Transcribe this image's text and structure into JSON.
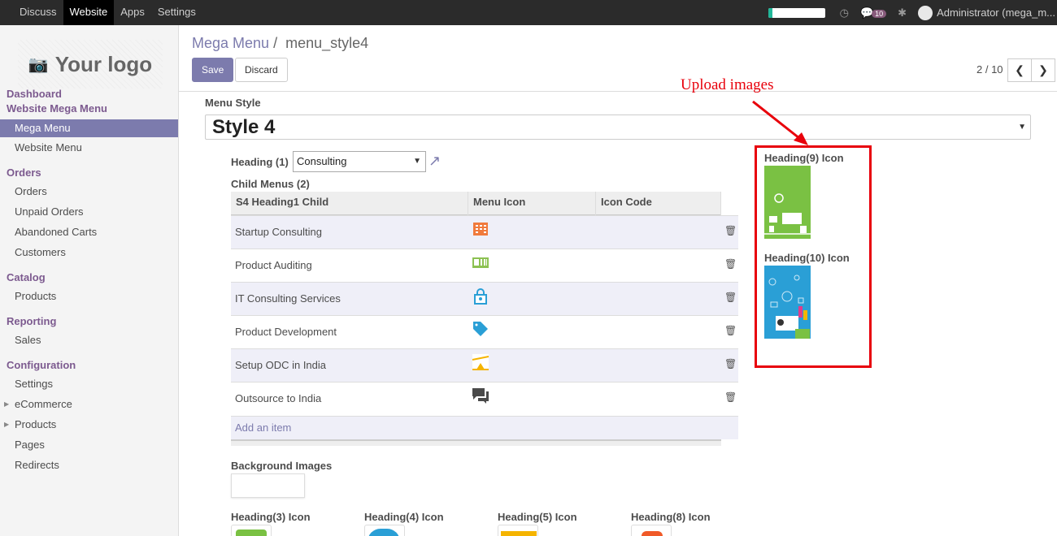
{
  "topbar": {
    "menu": [
      "Discuss",
      "Website",
      "Apps",
      "Settings"
    ],
    "active": "Website",
    "badge": "10",
    "user": "Administrator (mega_m..."
  },
  "sidebar": {
    "logo_text": "Your logo",
    "sections": [
      {
        "title": "Dashboard"
      },
      {
        "title": "Website Mega Menu",
        "items": [
          "Mega Menu",
          "Website Menu"
        ]
      },
      {
        "title": "Orders",
        "items": [
          "Orders",
          "Unpaid Orders",
          "Abandoned Carts",
          "Customers"
        ]
      },
      {
        "title": "Catalog",
        "items": [
          "Products"
        ]
      },
      {
        "title": "Reporting",
        "items": [
          "Sales"
        ]
      },
      {
        "title": "Configuration",
        "items": [
          "Settings",
          "eCommerce",
          "Products",
          "Pages",
          "Redirects"
        ]
      }
    ]
  },
  "breadcrumb": {
    "parent": "Mega Menu",
    "separator": "/",
    "current": "menu_style4"
  },
  "buttons": {
    "save": "Save",
    "discard": "Discard"
  },
  "pager": {
    "text": "2 / 10",
    "prev": "❮",
    "next": "❯"
  },
  "form": {
    "menu_style_label": "Menu Style",
    "menu_style_value": "Style 4",
    "heading_label": "Heading (1)",
    "heading_value": "Consulting",
    "child_menus_label": "Child Menus (2)",
    "columns": [
      "S4 Heading1 Child",
      "Menu Icon",
      "Icon Code"
    ],
    "rows": [
      {
        "name": "Startup Consulting",
        "icon": "building-icon",
        "color": "#f07a3c"
      },
      {
        "name": "Product Auditing",
        "icon": "id-card-icon",
        "color": "#8cc152"
      },
      {
        "name": "IT Consulting Services",
        "icon": "lock-icon",
        "color": "#2a9fd6"
      },
      {
        "name": "Product Development",
        "icon": "tag-icon",
        "color": "#2a9fd6"
      },
      {
        "name": "Setup ODC in India",
        "icon": "triangle-icon",
        "color": "#f5b400"
      },
      {
        "name": "Outsource to India",
        "icon": "chat-icon",
        "color": "#4a4a4a"
      }
    ],
    "add_item": "Add an item",
    "background_images_label": "Background Images",
    "heading_icons": [
      "Heading(3) Icon",
      "Heading(4) Icon",
      "Heading(5) Icon",
      "Heading(8) Icon"
    ],
    "heading_icon_colors": [
      "#7ac143",
      "#2a9fd6",
      "#f5b400",
      "#f05a28"
    ],
    "heading9_label": "Heading(9) Icon",
    "heading10_label": "Heading(10) Icon"
  },
  "annotation": "Upload images"
}
